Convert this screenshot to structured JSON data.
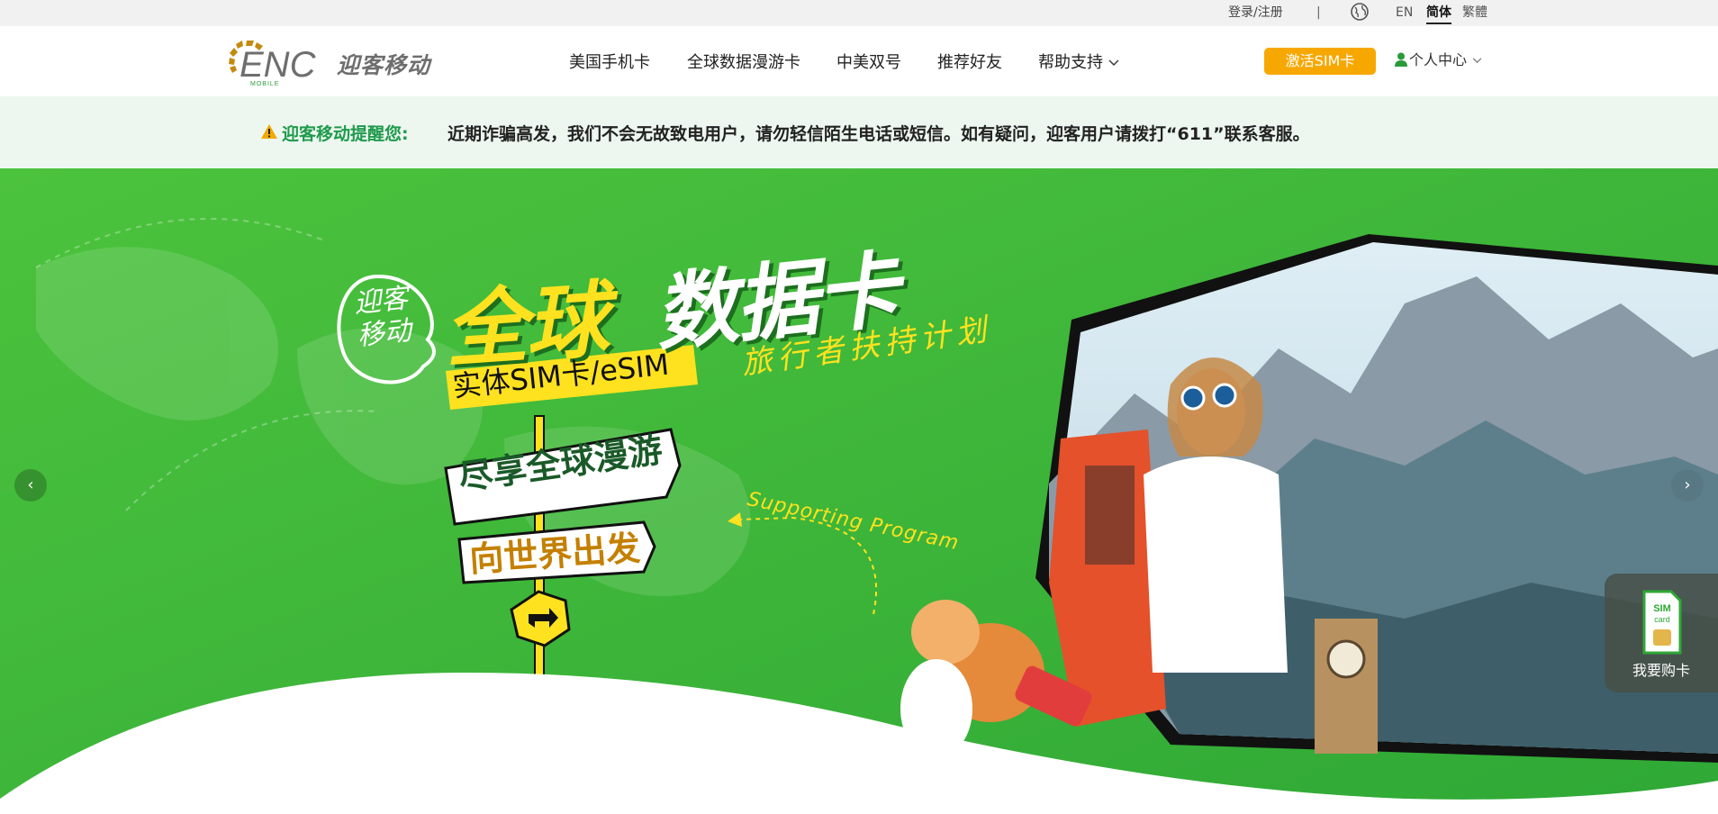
{
  "topbar": {
    "login": "登录/注册",
    "separator": "|",
    "lang_en": "EN",
    "lang_zh_hans": "简体",
    "lang_zh_hant": "繁體"
  },
  "header": {
    "brand_cn": "迎客移动",
    "nav": [
      "美国手机卡",
      "全球数据漫游卡",
      "中美双号",
      "推荐好友",
      "帮助支持"
    ],
    "activate_button": "激活SIM卡",
    "account": "个人中心"
  },
  "notice": {
    "label": "迎客移动提醒您:",
    "message": "近期诈骗高发，我们不会无故致电用户，请勿轻信陌生电话或短信。如有疑问，迎客用户请拨打“611”联系客服。"
  },
  "hero": {
    "bubble": "迎客移动",
    "headline_global": "全球",
    "headline_card": "数据卡",
    "sim_type": "实体SIM卡/eSIM",
    "travel_plan": "旅行者扶持计划",
    "sign1": "尽享全球漫游",
    "sign2": "向世界出发",
    "supporting": "Supporting Program",
    "prev": "‹",
    "next": "›"
  },
  "float_buy": {
    "label": "我要购卡"
  },
  "colors": {
    "brand_green": "#3cb83a",
    "accent_orange": "#f7a800",
    "notice_bg": "#edf7ef",
    "notice_label": "#1f9a4c",
    "headline_yellow": "#ffe21f"
  }
}
